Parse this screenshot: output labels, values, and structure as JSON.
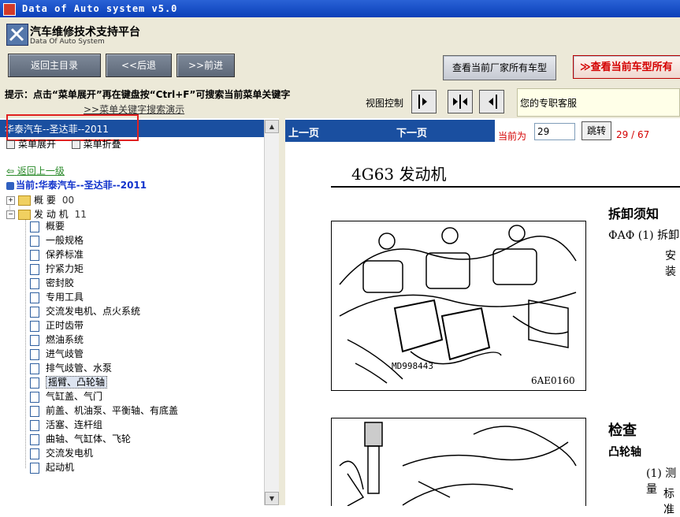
{
  "window": {
    "title": "Data of Auto system v5.0"
  },
  "app": {
    "title": "汽车维修技术支持平台",
    "subtitle": "Data Of Auto System"
  },
  "toolbar": {
    "home_label": "返回主目录",
    "back_label": "<<后退",
    "forward_label": ">>前进",
    "maker_label": "查看当前厂家所有车型",
    "model_label": "≫查看当前车型所有"
  },
  "hint": {
    "text": "提示：点击“菜单展开”再在键盘按“Ctrl+F”可搜索当前菜单关键字",
    "link": ">>菜单关键字搜索演示"
  },
  "view": {
    "label": "视图控制"
  },
  "support": {
    "text": "您的专职客服"
  },
  "left": {
    "header_title": "华泰汽车--圣达菲--2011",
    "expand_label": "菜单展开",
    "collapse_label": "菜单折叠",
    "back_level": "返回上一级",
    "current": "当前:华泰汽车--圣达菲--2011",
    "tree": [
      {
        "label": "概  要",
        "count": "00",
        "sign": "+"
      },
      {
        "label": "发 动 机",
        "count": "11",
        "sign": "−"
      }
    ],
    "leaves": [
      "概要",
      "一般规格",
      "保养标准",
      "拧紧力矩",
      "密封胶",
      "专用工具",
      "交流发电机、点火系统",
      "正时齿带",
      "燃油系统",
      "进气歧管",
      "排气歧管、水泵",
      "摇臂、凸轮轴",
      "气缸盖、气门",
      "前盖、机油泵、平衡轴、有底盖",
      "活塞、连杆组",
      "曲轴、气缸体、飞轮",
      "交流发电机",
      "起动机"
    ],
    "selected_index": 11
  },
  "nav": {
    "prev": "上一页",
    "next": "下一页",
    "current_label": "当前为",
    "page_value": "29",
    "jump_label": "跳转",
    "page_count": "29 / 67"
  },
  "doc": {
    "title": "4G63 发动机",
    "fig1_caption": "6AE0160",
    "fig1_mark": "MD998443",
    "remove_heading": "拆卸须知",
    "remove_line1": "ФAФ (1) 拆卸",
    "remove_line2": "安装",
    "check_heading": "检查",
    "cam_heading": "凸轮轴",
    "check_line1": "(1) 测量",
    "check_line2": "标准"
  }
}
